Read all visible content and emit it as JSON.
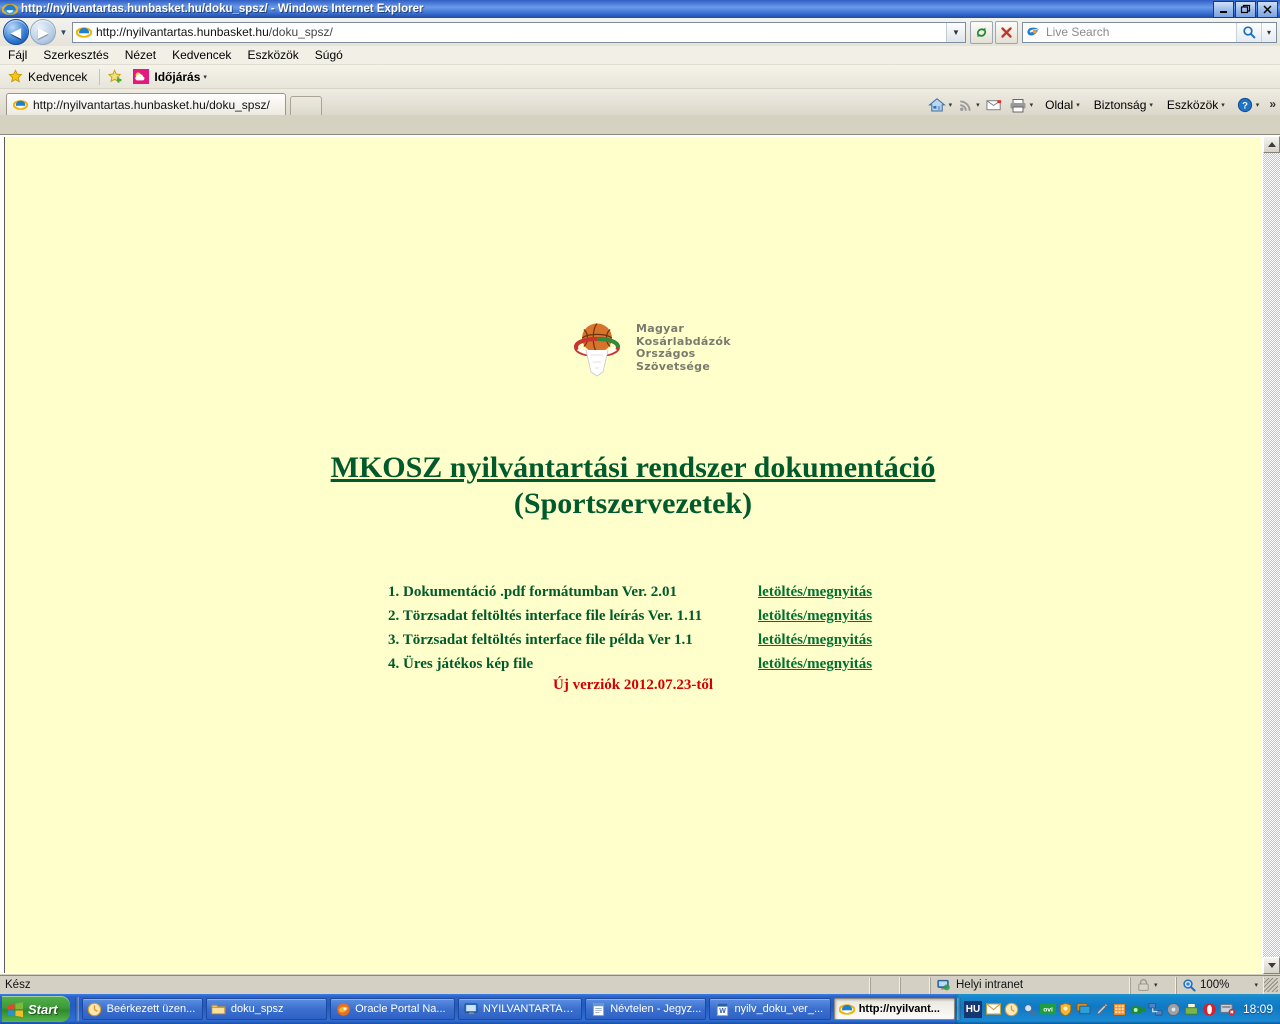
{
  "window": {
    "title": "http://nyilvantartas.hunbasket.hu/doku_spsz/ - Windows Internet Explorer",
    "minimize": "_",
    "maximize": "❐",
    "close": "✕"
  },
  "nav": {
    "back": "◀",
    "forward": "▶",
    "history_caret": "▼",
    "address_domain": "http://nyilvantartas.hunbasket.hu",
    "address_path": "/doku_spsz/",
    "address_full": "http://nyilvantartas.hunbasket.hu/doku_spsz/",
    "refresh": "↻",
    "stop": "✕",
    "search_placeholder": "Live Search",
    "search_value": "",
    "search_button": "search-icon",
    "search_caret": "▾"
  },
  "menubar": {
    "items": [
      {
        "label": "Fájl"
      },
      {
        "label": "Szerkesztés"
      },
      {
        "label": "Nézet"
      },
      {
        "label": "Kedvencek"
      },
      {
        "label": "Eszközök"
      },
      {
        "label": "Súgó"
      }
    ]
  },
  "favoritesbar": {
    "favorites_label": "Kedvencek",
    "add_icon": "add-favorite-icon",
    "items": [
      {
        "label": "Időjárás",
        "icon": "weather-icon",
        "caret": "▾"
      }
    ]
  },
  "tabs": {
    "items": [
      {
        "label": "http://nyilvantartas.hunbasket.hu/doku_spsz/",
        "icon": "ie-page-icon",
        "active": true
      }
    ],
    "new_tab_label": ""
  },
  "commandbar": {
    "items": [
      {
        "label": "",
        "icon": "home-icon",
        "caret": "▾"
      },
      {
        "label": "",
        "icon": "rss-icon",
        "caret": "▾"
      },
      {
        "label": "",
        "icon": "mail-icon",
        "caret": ""
      },
      {
        "label": "",
        "icon": "print-icon",
        "caret": "▾"
      },
      {
        "label": "Oldal",
        "icon": "",
        "caret": "▾"
      },
      {
        "label": "Biztonság",
        "icon": "",
        "caret": "▾"
      },
      {
        "label": "Eszközök",
        "icon": "",
        "caret": "▾"
      },
      {
        "label": "",
        "icon": "help-icon",
        "caret": "▾"
      }
    ],
    "overflow": "»"
  },
  "page": {
    "background_color": "#ffffcc",
    "logo": {
      "alt": "mkosz-logo",
      "lines": [
        "Magyar",
        "Kosárlabdázók",
        "Országos",
        "Szövetsége"
      ]
    },
    "title_line1": "MKOSZ nyilvántartási rendszer dokumentáció",
    "title_line2": "(Sportszervezetek)",
    "title_color": "#005a2b",
    "documents": [
      {
        "label": "1. Dokumentáció .pdf formátumban Ver. 2.01",
        "link": "letöltés/megnyitás"
      },
      {
        "label": "2. Törzsadat feltöltés interface file leírás Ver. 1.11",
        "link": "letöltés/megnyitás"
      },
      {
        "label": "3. Törzsadat feltöltés interface file példa Ver 1.1",
        "link": "letöltés/megnyitás"
      },
      {
        "label": "4. Üres játékos kép file",
        "link": "letöltés/megnyitás"
      }
    ],
    "news_note": "Új verziók 2012.07.23-től",
    "news_note_color": "#d40000"
  },
  "scrollbar": {
    "up_arrow": "▲",
    "down_arrow": "▼"
  },
  "statusbar": {
    "status": "Kész",
    "zone": "Helyi intranet",
    "zone_icon": "intranet-icon",
    "protected_icon": "lock-icon",
    "protected_caret": "▾",
    "zoom_icon": "zoom-icon",
    "zoom_level": "100%",
    "zoom_caret": "▾"
  },
  "taskbar": {
    "start_label": "Start",
    "buttons": [
      {
        "label": "Beérkezett üzen...",
        "icon": "outlook-icon",
        "active": false
      },
      {
        "label": "doku_spsz",
        "icon": "folder-icon",
        "active": false
      },
      {
        "label": "Oracle Portal Na...",
        "icon": "firefox-icon",
        "active": false
      },
      {
        "label": "NYILVANTARTAS...",
        "icon": "terminal-icon",
        "active": false
      },
      {
        "label": "Névtelen - Jegyz...",
        "icon": "notepad-icon",
        "active": false
      },
      {
        "label": "nyilv_doku_ver_...",
        "icon": "word-icon",
        "active": false
      },
      {
        "label": "http://nyilvant...",
        "icon": "ie-icon",
        "active": true
      }
    ],
    "tray": {
      "language": "HU",
      "icons": [
        "mail-icon",
        "clock-icon",
        "search-icon",
        "ovi-icon",
        "shield-icon",
        "display-icon",
        "pen-icon",
        "calculator-icon",
        "camera-icon",
        "network-icon",
        "disc-icon",
        "scanner-icon",
        "opera-icon",
        "safe-remove-icon"
      ],
      "clock": "18:09"
    }
  }
}
